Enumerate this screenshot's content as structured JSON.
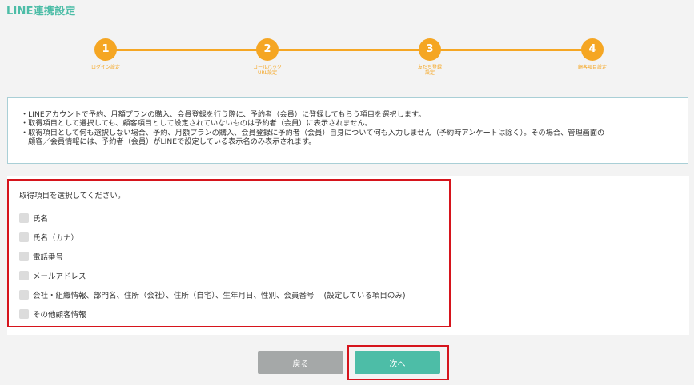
{
  "page": {
    "title": "LINE連携設定"
  },
  "stepper": {
    "steps": [
      {
        "number": "1",
        "label": "ログイン設定"
      },
      {
        "number": "2",
        "label": "コールバック\nURL設定"
      },
      {
        "number": "3",
        "label": "友だち登録\n設定"
      },
      {
        "number": "4",
        "label": "顧客項目設定"
      }
    ],
    "accent_color": "#f5a623"
  },
  "info": {
    "lines": [
      "・LINEアカウントで予約、月額プランの購入、会員登録を行う際に、予約者（会員）に登録してもらう項目を選択します。",
      "・取得項目として選択しても、顧客項目として設定されていないものは予約者（会員）に表示されません。",
      "・取得項目として何も選択しない場合、予約、月額プランの購入、会員登録に予約者（会員）自身について何も入力しません（予約時アンケートは除く）。その場合、管理画面の",
      "　顧客／会員情報には、予約者（会員）がLINEで設定している表示名のみ表示されます。"
    ]
  },
  "selection": {
    "prompt": "取得項目を選択してください。",
    "options": [
      {
        "label": "氏名",
        "note": ""
      },
      {
        "label": "氏名（カナ）",
        "note": ""
      },
      {
        "label": "電話番号",
        "note": ""
      },
      {
        "label": "メールアドレス",
        "note": ""
      },
      {
        "label": "会社・組織情報、部門名、住所（会社）、住所（自宅）、生年月日、性別、会員番号",
        "note": "(設定している項目のみ)"
      },
      {
        "label": "その他顧客情報",
        "note": ""
      }
    ]
  },
  "actions": {
    "back_label": "戻る",
    "next_label": "次へ"
  },
  "colors": {
    "brand": "#4dbda7",
    "highlight": "#d6141c",
    "back_button": "#a5a8a8"
  }
}
